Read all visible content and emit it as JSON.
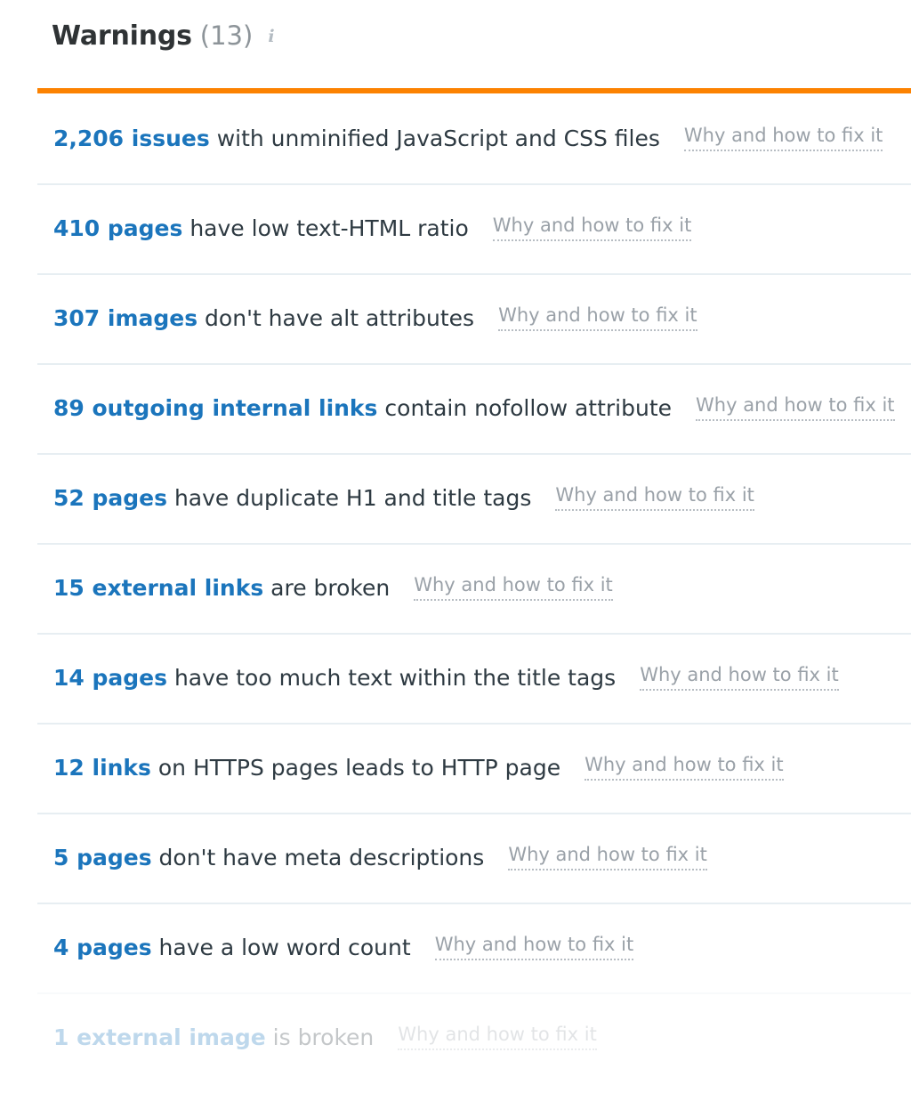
{
  "header": {
    "title": "Warnings",
    "count": "(13)",
    "info_icon": "info-icon",
    "accent_color": "#fc8201"
  },
  "link_color": "#1b75bc",
  "text_color": "#2e3a42",
  "fix_link_color": "#9aa1a8",
  "issues": [
    {
      "count": "2,206 issues",
      "description": " with unminified JavaScript and CSS files",
      "fix_label": "Why and how to fix it",
      "faded": false
    },
    {
      "count": "410 pages",
      "description": " have low text-HTML ratio",
      "fix_label": "Why and how to fix it",
      "faded": false
    },
    {
      "count": "307 images",
      "description": " don't have alt attributes",
      "fix_label": "Why and how to fix it",
      "faded": false
    },
    {
      "count": "89 outgoing internal links",
      "description": " contain nofollow attribute",
      "fix_label": "Why and how to fix it",
      "faded": false
    },
    {
      "count": "52 pages",
      "description": " have duplicate H1 and title tags",
      "fix_label": "Why and how to fix it",
      "faded": false
    },
    {
      "count": "15 external links",
      "description": " are broken",
      "fix_label": "Why and how to fix it",
      "faded": false
    },
    {
      "count": "14 pages",
      "description": " have too much text within the title tags",
      "fix_label": "Why and how to fix it",
      "faded": false
    },
    {
      "count": "12 links",
      "description": " on HTTPS pages leads to HTTP page",
      "fix_label": "Why and how to fix it",
      "faded": false
    },
    {
      "count": "5 pages",
      "description": " don't have meta descriptions",
      "fix_label": "Why and how to fix it",
      "faded": false
    },
    {
      "count": "4 pages",
      "description": " have a low word count",
      "fix_label": "Why and how to fix it",
      "faded": false
    },
    {
      "count": "1 external image",
      "description": " is broken",
      "fix_label": "Why and how to fix it",
      "faded": true
    }
  ]
}
